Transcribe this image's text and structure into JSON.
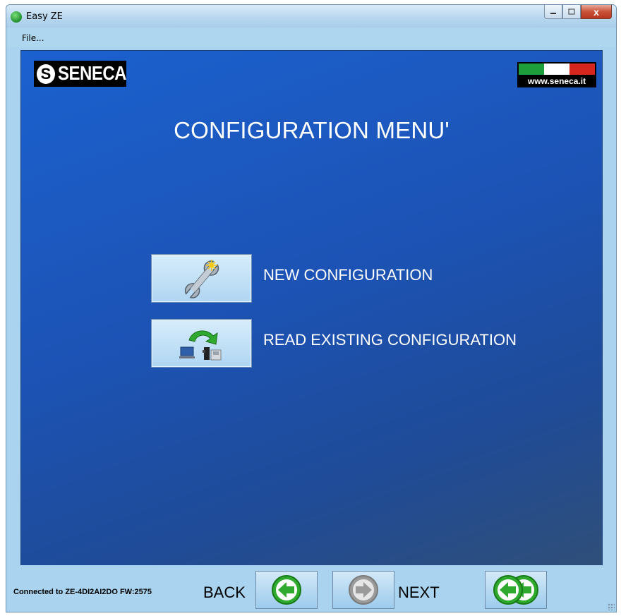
{
  "window": {
    "title": "Easy ZE",
    "close_symbol": "x"
  },
  "menu": {
    "file_label": "File..."
  },
  "brand": {
    "logo_text": "SENECA",
    "logo_mark": "S",
    "website": "www.seneca.it",
    "flag_colors": [
      "#1e9e3a",
      "#ffffff",
      "#d7261e"
    ]
  },
  "main": {
    "heading": "CONFIGURATION MENU'",
    "options": [
      {
        "label": "NEW CONFIGURATION",
        "icon": "wrench-icon"
      },
      {
        "label": "READ EXISTING CONFIGURATION",
        "icon": "read-device-icon"
      }
    ]
  },
  "status": {
    "connection": "Connected to ZE-4DI2AI2DO FW:2575",
    "back_label": "BACK",
    "next_label": "NEXT"
  },
  "colors": {
    "accent_green": "#2faa2f",
    "disabled_gray": "#9a9a9a"
  }
}
